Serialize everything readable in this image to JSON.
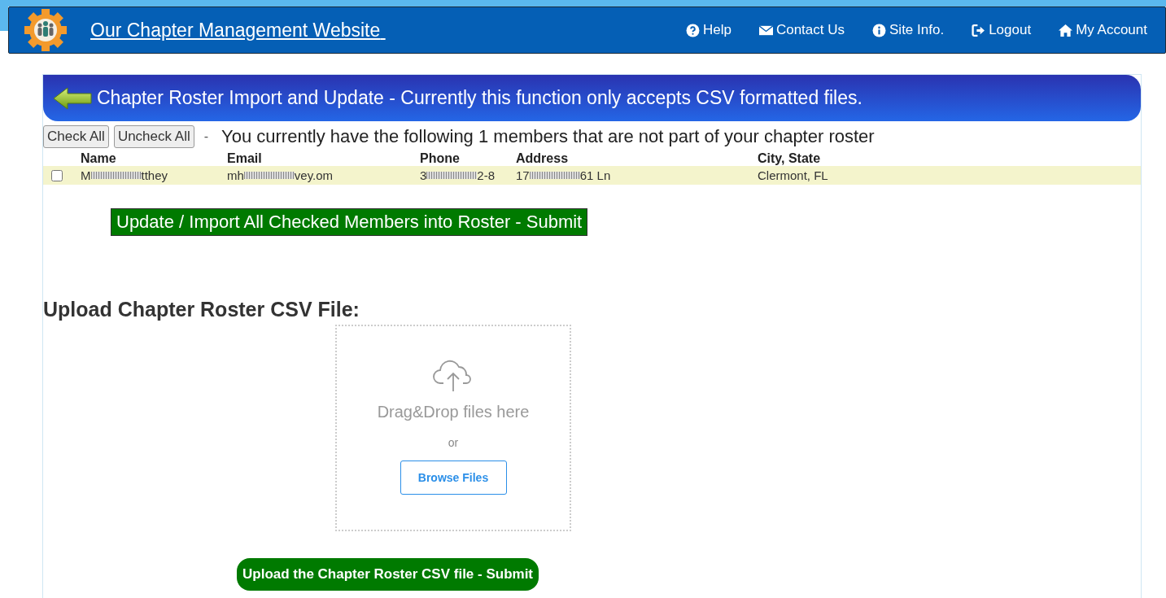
{
  "header": {
    "site_title": "Our Chapter Management Website",
    "nav": [
      {
        "kind": "help",
        "label": "Help"
      },
      {
        "kind": "mail",
        "label": "Contact Us"
      },
      {
        "kind": "info",
        "label": "Site Info."
      },
      {
        "kind": "logout",
        "label": "Logout"
      },
      {
        "kind": "home",
        "label": "My Account"
      }
    ]
  },
  "banner": {
    "title": "Chapter Roster Import and Update - Currently this function only accepts CSV formatted files."
  },
  "toolbar": {
    "buttons": [
      "Check All",
      "Uncheck All"
    ],
    "separator": "-",
    "message": "You currently have the following 1 members that are not part of your chapter roster"
  },
  "table": {
    "columns": [
      "Name",
      "Email",
      "Phone",
      "Address",
      "City, State"
    ],
    "rows": [
      {
        "checked": false,
        "cells": [
          {
            "before": "M",
            "after": "tthey"
          },
          {
            "before": "mh",
            "after": "vey.om"
          },
          {
            "before": "3",
            "after": "2-8"
          },
          {
            "before": "17",
            "after": "61 Ln"
          },
          {
            "before": "Clermont, FL"
          }
        ]
      }
    ]
  },
  "import_button": "Update / Import All Checked Members into Roster - Submit",
  "upload": {
    "heading": "Upload Chapter Roster CSV File:",
    "drop_text": "Drag&Drop files here",
    "or": "or",
    "browse": "Browse Files",
    "submit": "Upload the Chapter Roster CSV file - Submit"
  }
}
